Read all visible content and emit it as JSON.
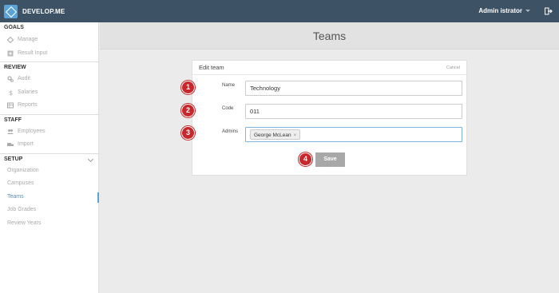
{
  "header": {
    "logo_text": "DEVELOP.ME",
    "user_name": "Admin istrator",
    "brand_color": "#3e5266",
    "accent_color": "#5aa4d9"
  },
  "sidebar": {
    "sections": [
      {
        "title": "GOALS",
        "items": [
          {
            "label": "Manage",
            "icon": "diamond-icon"
          },
          {
            "label": "Result Input",
            "icon": "plus-box-icon"
          }
        ]
      },
      {
        "title": "REVIEW",
        "items": [
          {
            "label": "Audit",
            "icon": "gears-icon"
          },
          {
            "label": "Salaries",
            "icon": "dollar-icon"
          },
          {
            "label": "Reports",
            "icon": "table-icon"
          }
        ]
      },
      {
        "title": "STAFF",
        "items": [
          {
            "label": "Employees",
            "icon": "users-icon"
          },
          {
            "label": "Import",
            "icon": "truck-icon"
          }
        ]
      },
      {
        "title": "SETUP",
        "items": [
          {
            "label": "Organization"
          },
          {
            "label": "Campuses"
          },
          {
            "label": "Teams"
          },
          {
            "label": "Job Grades"
          },
          {
            "label": "Review Years"
          }
        ]
      }
    ]
  },
  "page": {
    "title": "Teams"
  },
  "form": {
    "header": "Edit team",
    "cancel_label": "Cancel",
    "name_label": "Name",
    "name_value": "Technology",
    "code_label": "Code",
    "code_value": "011",
    "admins_label": "Admins",
    "admin_tag": "George McLean",
    "remove_glyph": "×",
    "save_label": "Save"
  },
  "annotations": [
    "1",
    "2",
    "3",
    "4"
  ]
}
